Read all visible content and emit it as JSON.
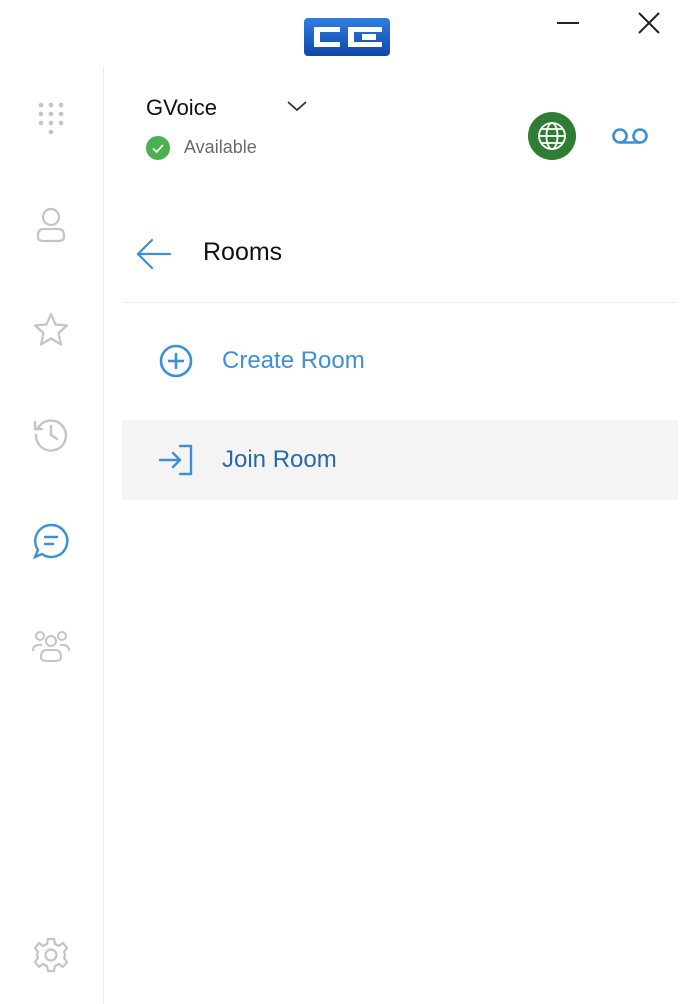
{
  "window": {
    "logo_icon": "cc-logo-icon",
    "minimize_icon": "minimize-icon",
    "close_icon": "close-icon"
  },
  "sidebar": {
    "items": [
      {
        "icon": "dialpad-icon"
      },
      {
        "icon": "contacts-icon"
      },
      {
        "icon": "star-icon"
      },
      {
        "icon": "history-icon"
      },
      {
        "icon": "chat-icon",
        "active": true
      },
      {
        "icon": "group-icon"
      },
      {
        "icon": "gear-icon"
      }
    ]
  },
  "account": {
    "name": "GVoice",
    "status": "Available",
    "status_color": "#4caf50"
  },
  "header_actions": {
    "globe_color": "#2e7d32",
    "voicemail_color": "#3d8fd6"
  },
  "page": {
    "title": "Rooms"
  },
  "menu": [
    {
      "label": "Create Room",
      "icon": "plus-circle-icon"
    },
    {
      "label": "Join Room",
      "icon": "join-icon"
    }
  ],
  "colors": {
    "accent": "#3d8fd6",
    "inactive_icon": "#c4c4c4",
    "selected_row_bg": "#f4f4f4"
  }
}
